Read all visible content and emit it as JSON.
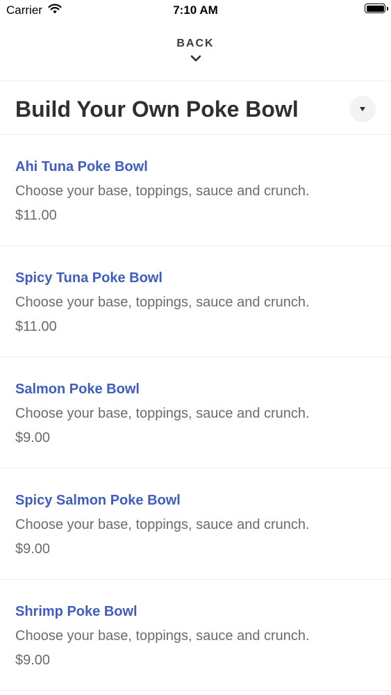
{
  "status_bar": {
    "carrier": "Carrier",
    "time": "7:10 AM",
    "icons": [
      "wifi-icon",
      "battery-icon"
    ]
  },
  "nav": {
    "back_label": "BACK",
    "icon": "chevron-down-icon"
  },
  "section": {
    "title": "Build Your Own Poke Bowl",
    "toggle_icon": "caret-down-icon"
  },
  "colors": {
    "item_name": "#3f5cbf",
    "body_text": "#6b6b6b",
    "divider": "#eceef0"
  },
  "items": [
    {
      "name": "Ahi Tuna Poke Bowl",
      "description": "Choose your base, toppings, sauce and crunch.",
      "price": "$11.00"
    },
    {
      "name": "Spicy Tuna Poke Bowl",
      "description": "Choose your base, toppings, sauce and crunch.",
      "price": "$11.00"
    },
    {
      "name": "Salmon Poke Bowl",
      "description": "Choose your base, toppings, sauce and crunch.",
      "price": "$9.00"
    },
    {
      "name": "Spicy Salmon Poke Bowl",
      "description": "Choose your base, toppings, sauce and crunch.",
      "price": "$9.00"
    },
    {
      "name": "Shrimp Poke Bowl",
      "description": "Choose your base, toppings, sauce and crunch.",
      "price": "$9.00"
    }
  ]
}
